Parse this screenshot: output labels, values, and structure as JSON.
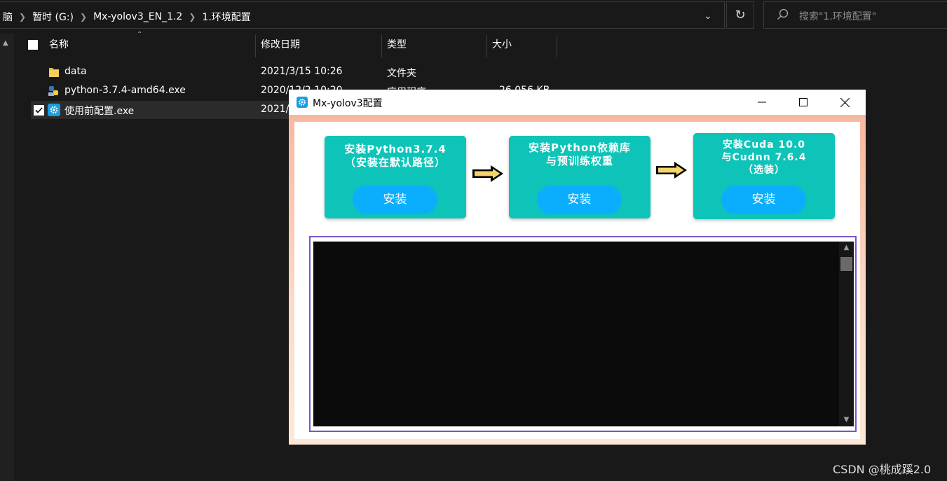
{
  "explorer": {
    "breadcrumbs": [
      "脑",
      "暂时 (G:)",
      "Mx-yolov3_EN_1.2",
      "1.环境配置"
    ],
    "search_placeholder": "搜索\"1.环境配置\"",
    "columns": {
      "name": "名称",
      "modified": "修改日期",
      "type": "类型",
      "size": "大小"
    },
    "files": [
      {
        "name": "data",
        "modified": "2021/3/15 10:26",
        "type": "文件夹",
        "size": "",
        "icon": "folder-icon"
      },
      {
        "name": "python-3.7.4-amd64.exe",
        "modified": "2020/12/2 10:20",
        "type": "应用程序",
        "size": "26,056 KB",
        "icon": "python-installer-icon"
      },
      {
        "name": "使用前配置.exe",
        "modified": "2021/",
        "type": "",
        "size": "",
        "icon": "gear-app-icon",
        "selected": true,
        "checked": true
      }
    ]
  },
  "app_window": {
    "title": "Mx-yolov3配置",
    "steps": [
      {
        "title": "安装Python3.7.4\n（安装在默认路径）",
        "button": "安装"
      },
      {
        "title": "安装Python依赖库\n与预训练权重",
        "button": "安装"
      },
      {
        "title": "安装Cuda 10.0\n与Cudnn 7.6.4\n（选装）",
        "button": "安装"
      }
    ]
  },
  "watermark": "CSDN @桃成蹊2.0",
  "colors": {
    "card": "#0ec4b8",
    "button": "#0aaefc",
    "console_border": "#7b55c7",
    "arrow_fill": "#f5d56a"
  }
}
